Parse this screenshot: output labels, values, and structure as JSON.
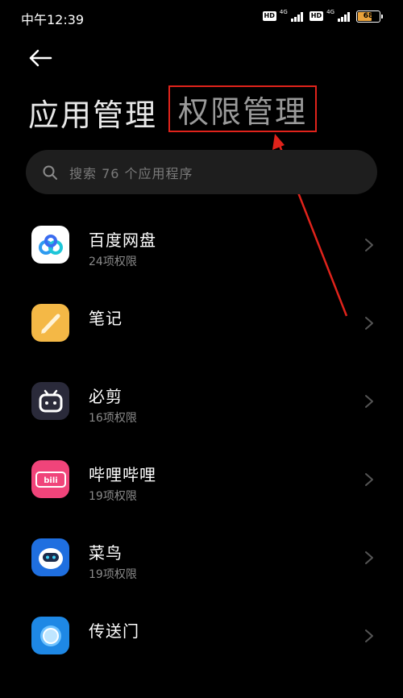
{
  "status_bar": {
    "time": "中午12:39",
    "hd_label": "HD",
    "network_1": "4G",
    "network_2": "4G",
    "battery_level": "68",
    "battery_color": "#e9a23b"
  },
  "header": {
    "back_icon": "arrow-left-icon",
    "title": "应用管理",
    "annotation_text": "权限管理",
    "annotation_color": "#e0231b"
  },
  "search": {
    "icon": "search-icon",
    "placeholder": "搜索 76 个应用程序"
  },
  "apps": [
    {
      "name": "百度网盘",
      "detail": "24项权限",
      "icon": "baidu-netdisk-icon",
      "icon_bg": "#ffffff"
    },
    {
      "name": "笔记",
      "detail": "",
      "icon": "notes-icon",
      "icon_bg": "#f4b846"
    },
    {
      "name": "必剪",
      "detail": "16项权限",
      "icon": "bijian-icon",
      "icon_bg": "#2a2a3a"
    },
    {
      "name": "哔哩哔哩",
      "detail": "19项权限",
      "icon": "bilibili-icon",
      "icon_bg": "#f0447a"
    },
    {
      "name": "菜鸟",
      "detail": "19项权限",
      "icon": "cainiao-icon",
      "icon_bg": "#1f6fe0"
    },
    {
      "name": "传送门",
      "detail": "",
      "icon": "portal-icon",
      "icon_bg": "#1e88e5"
    }
  ]
}
